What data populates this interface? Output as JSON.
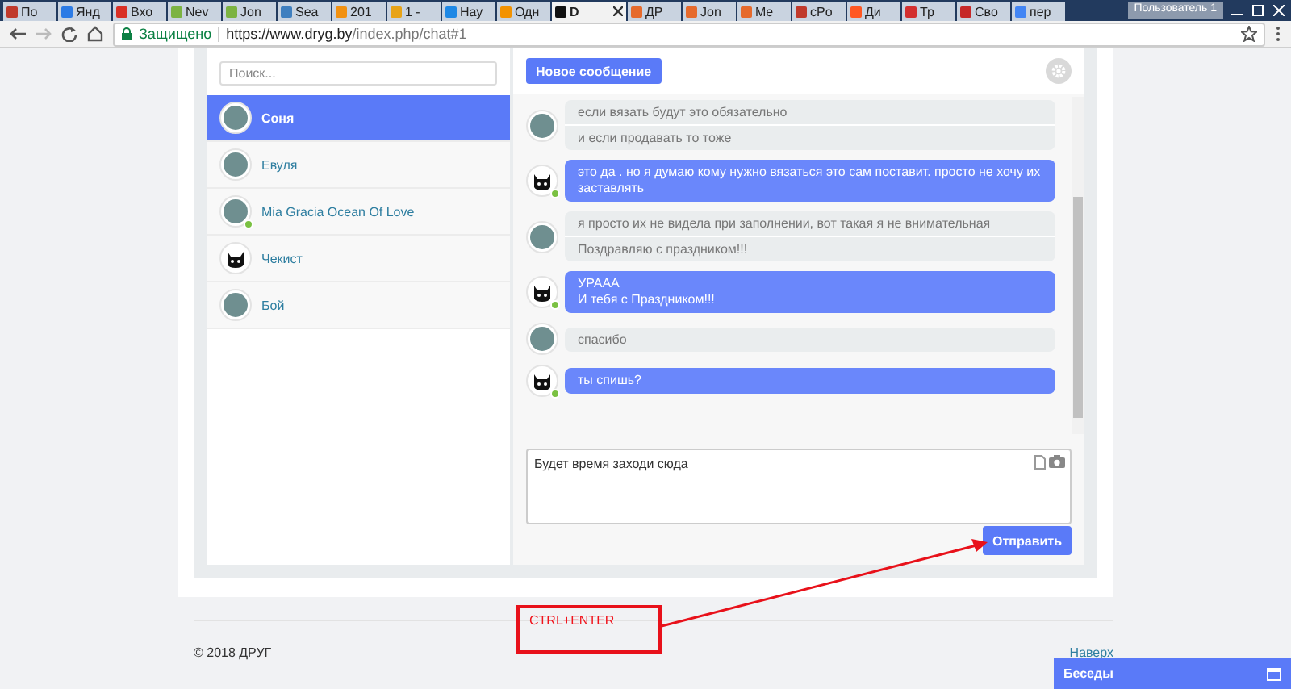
{
  "browser": {
    "tabs": [
      {
        "title": "По",
        "selected": false,
        "color": "#c0392b"
      },
      {
        "title": "Янд",
        "selected": false,
        "color": "#2c7be5"
      },
      {
        "title": "Вхо",
        "selected": false,
        "color": "#d93025"
      },
      {
        "title": "Nev",
        "selected": false,
        "color": "#7cb342"
      },
      {
        "title": "Jon",
        "selected": false,
        "color": "#7cb342"
      },
      {
        "title": "Sea",
        "selected": false,
        "color": "#3f7fbf"
      },
      {
        "title": "201",
        "selected": false,
        "color": "#f29111"
      },
      {
        "title": "1 -",
        "selected": false,
        "color": "#e8a317"
      },
      {
        "title": "Нау",
        "selected": false,
        "color": "#1e88e5"
      },
      {
        "title": "Одн",
        "selected": false,
        "color": "#f39200"
      },
      {
        "title": "D",
        "selected": true,
        "color": "#111111"
      },
      {
        "title": "ДР",
        "selected": false,
        "color": "#e66a2c"
      },
      {
        "title": "Jon",
        "selected": false,
        "color": "#e66a2c"
      },
      {
        "title": "Me",
        "selected": false,
        "color": "#e66a2c"
      },
      {
        "title": "cPo",
        "selected": false,
        "color": "#c0392b"
      },
      {
        "title": "Ди",
        "selected": false,
        "color": "#ff5722"
      },
      {
        "title": "Тр",
        "selected": false,
        "color": "#d32f2f"
      },
      {
        "title": "Сво",
        "selected": false,
        "color": "#c62828"
      },
      {
        "title": "пер",
        "selected": false,
        "color": "#4285f4"
      }
    ],
    "user": "Пользователь 1",
    "secure_label": "Защищено",
    "url_host": "https://www.dryg.by",
    "url_path": "/index.php/chat#1"
  },
  "search": {
    "placeholder": "Поиск..."
  },
  "new_message_button": "Новое сообщение",
  "contacts": [
    {
      "name": "Соня",
      "kind": "photo",
      "online": false,
      "selected": true
    },
    {
      "name": "Евуля",
      "kind": "photo",
      "online": false,
      "selected": false
    },
    {
      "name": "Mia Gracia Ocean Of Love",
      "kind": "photo",
      "online": true,
      "selected": false
    },
    {
      "name": "Чекист",
      "kind": "cat",
      "online": false,
      "selected": false
    },
    {
      "name": "Бой",
      "kind": "photo",
      "online": false,
      "selected": false
    }
  ],
  "messages": [
    {
      "mine": false,
      "kind": "photo",
      "online": false,
      "lines": [
        "если вязать будут это обязательно",
        "и если продавать то тоже"
      ]
    },
    {
      "mine": true,
      "kind": "cat",
      "online": true,
      "lines": [
        "это да . но я думаю кому нужно вязаться это сам поставит. просто не хочу их заставлять"
      ]
    },
    {
      "mine": false,
      "kind": "photo",
      "online": false,
      "lines": [
        "я просто их не видела при заполнении, вот такая я не внимательная",
        "Поздравляю с праздником!!!"
      ]
    },
    {
      "mine": true,
      "kind": "cat",
      "online": true,
      "lines": [
        "УРААА",
        "И тебя с Праздником!!!"
      ]
    },
    {
      "mine": false,
      "kind": "photo",
      "online": false,
      "lines": [
        "спасибо"
      ]
    },
    {
      "mine": true,
      "kind": "cat",
      "online": true,
      "lines": [
        "ты спишь?"
      ]
    }
  ],
  "compose": {
    "value": "Будет время заходи сюда"
  },
  "send_button": "Отправить",
  "annotation": {
    "text": "CTRL+ENTER"
  },
  "footer": {
    "copyright": "© 2018 ДРУГ",
    "top_link": "Наверх"
  },
  "conversations_bar": {
    "title": "Беседы"
  }
}
